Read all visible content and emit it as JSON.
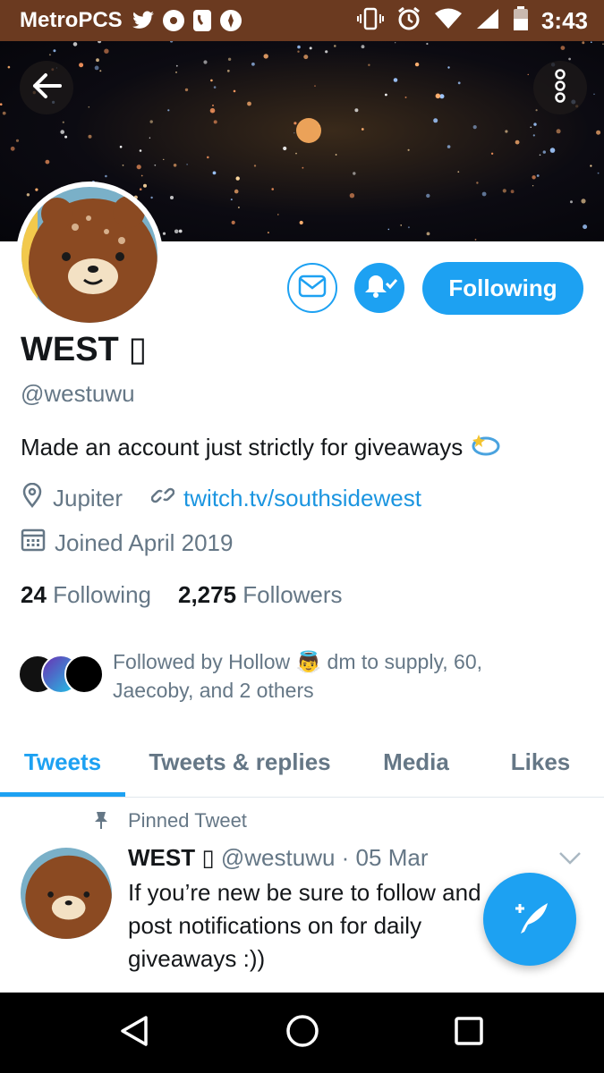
{
  "status_bar": {
    "carrier": "MetroPCS",
    "time": "3:43",
    "left_icons": [
      "twitter-icon",
      "notification-dot-icon",
      "phone-app-icon",
      "compass-icon"
    ],
    "right_icons": [
      "vibrate-icon",
      "alarm-icon",
      "wifi-icon",
      "signal-icon",
      "battery-icon"
    ]
  },
  "header": {
    "back_icon": "arrow-left-icon",
    "more_icon": "more-vertical-icon"
  },
  "profile": {
    "name": "WEST \u0000",
    "name_display": "WEST ▯",
    "handle": "@westuwu",
    "bio": "Made an account just strictly for giveaways",
    "bio_emoji_icon": "dizzy-star-icon",
    "location": "Jupiter",
    "website": "twitch.tv/southsidewest",
    "joined": "Joined April 2019",
    "following_count": "24",
    "following_label": "Following",
    "followers_count": "2,275",
    "followers_label": "Followers",
    "followed_by": "Followed by Hollow 👼 dm to supply, 60, Jaecoby, and 2 others"
  },
  "actions": {
    "message_icon": "mail-icon",
    "notify_icon": "bell-check-icon",
    "following_label": "Following"
  },
  "tabs": [
    {
      "label": "Tweets",
      "active": true
    },
    {
      "label": "Tweets & replies",
      "active": false
    },
    {
      "label": "Media",
      "active": false
    },
    {
      "label": "Likes",
      "active": false
    }
  ],
  "pinned_tweet": {
    "pinned_label": "Pinned Tweet",
    "author": "WEST ▯",
    "handle": "@westuwu",
    "date": "· 05 Mar",
    "text": "If you’re new be sure to follow and post notifications on for daily giveaways :))"
  },
  "colors": {
    "accent": "#1da1f2",
    "status_bar": "#6b3a20",
    "text_primary": "#14171a",
    "text_secondary": "#657786"
  }
}
